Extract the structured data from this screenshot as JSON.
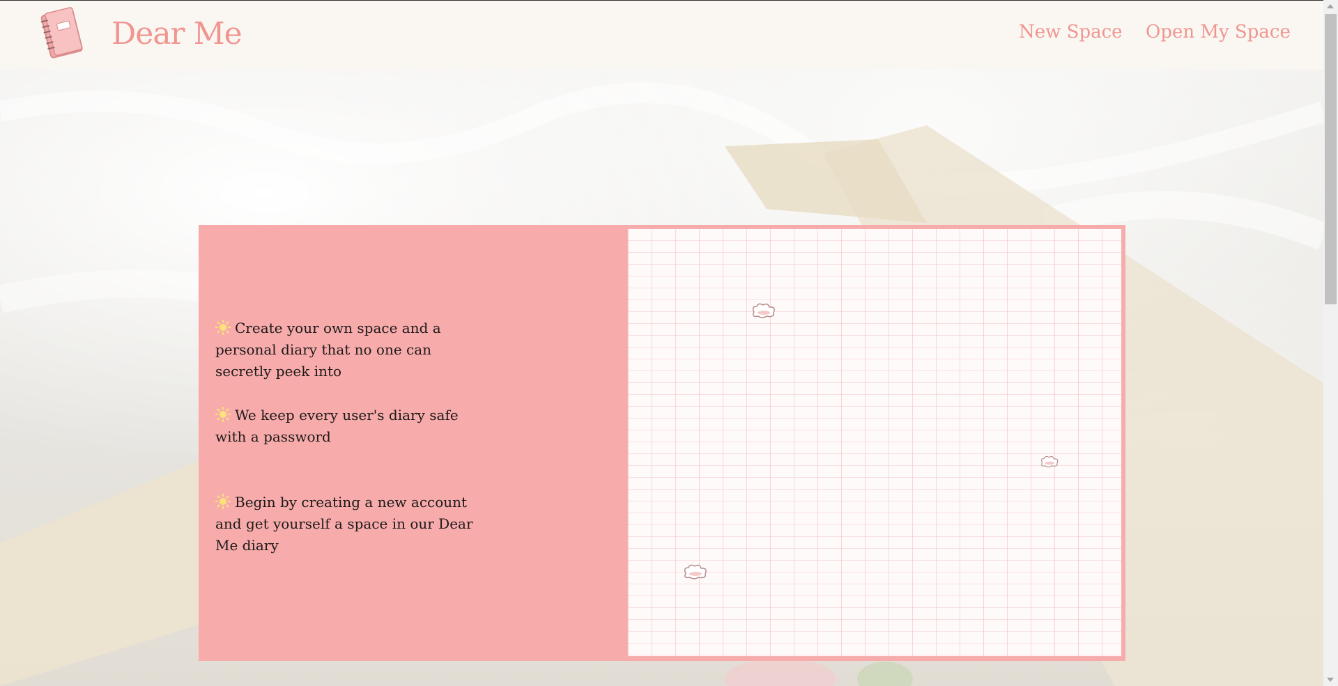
{
  "header": {
    "brand": "Dear Me",
    "nav": {
      "new_space": "New Space",
      "open_my_space": "Open My Space"
    },
    "logo_icon": "notebook-icon",
    "background": "#faf6f2",
    "accent": "#f0958f"
  },
  "card": {
    "background": "#f7abab",
    "features": [
      {
        "icon": "sun-icon",
        "text": "Create your own space and a personal diary that no one can secretly peek into"
      },
      {
        "icon": "sun-icon",
        "text": "We keep every user's diary safe with a password"
      },
      {
        "icon": "sun-icon",
        "text": "Begin by creating a new account and get yourself a space in our Dear Me diary"
      }
    ]
  }
}
